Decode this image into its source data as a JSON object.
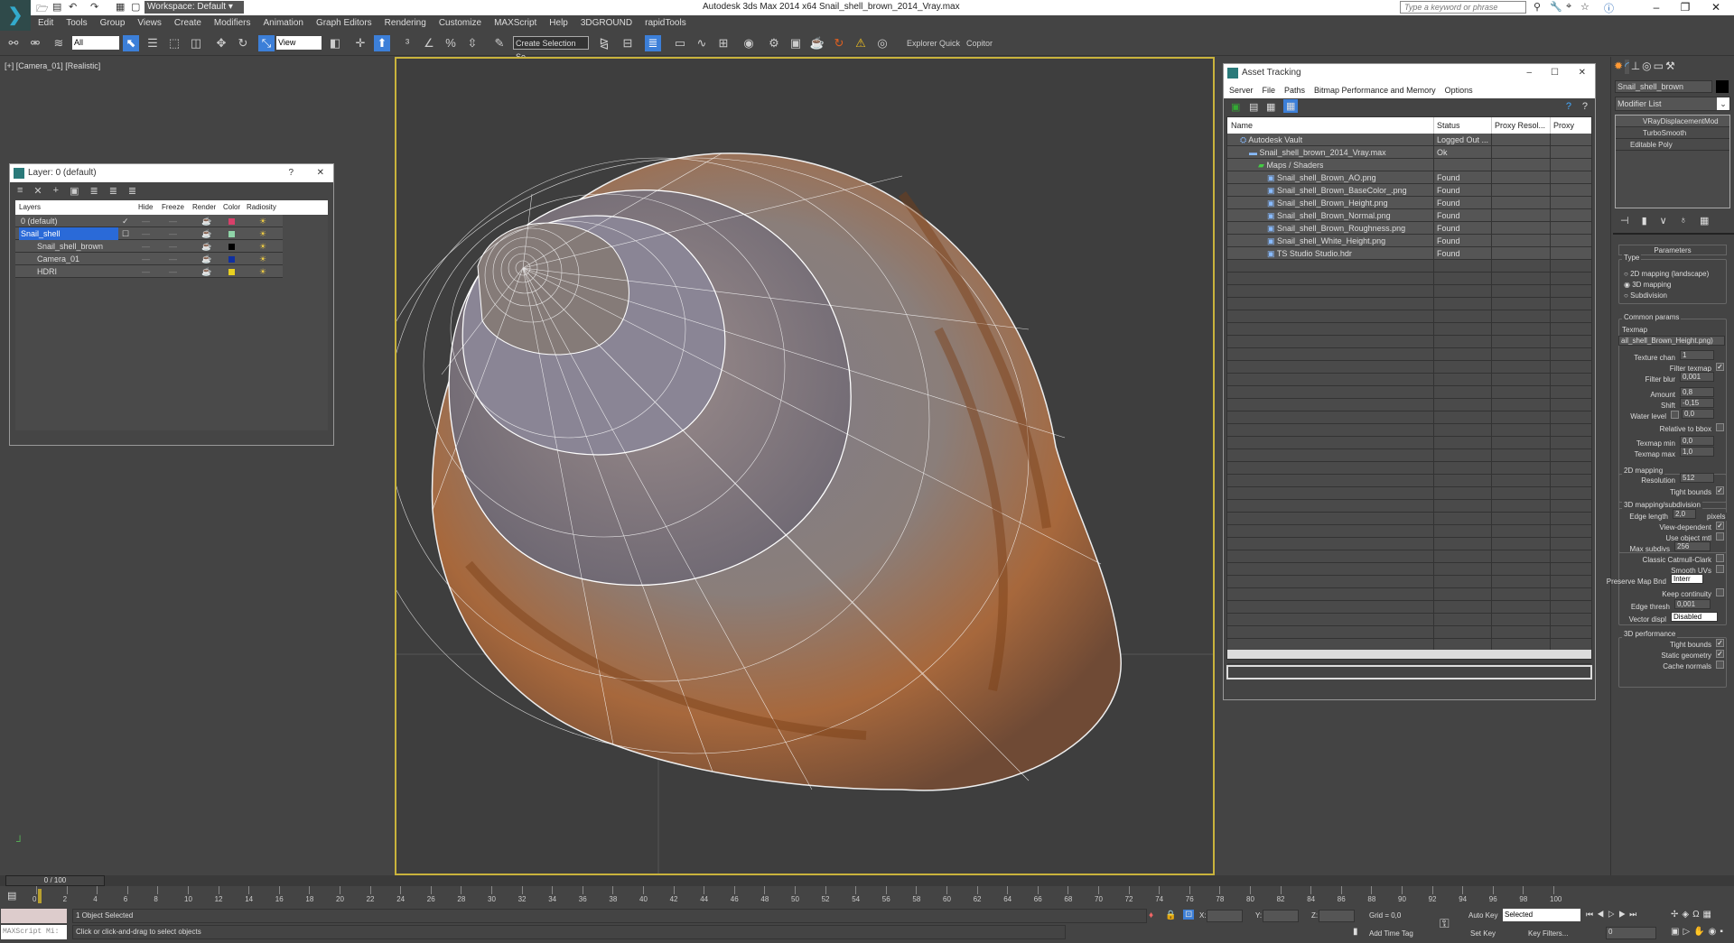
{
  "titlebar": {
    "workspace": "Workspace: Default",
    "title": "Autodesk 3ds Max  2014 x64     Snail_shell_brown_2014_Vray.max",
    "search_placeholder": "Type a keyword or phrase"
  },
  "menu": [
    "Edit",
    "Tools",
    "Group",
    "Views",
    "Create",
    "Modifiers",
    "Animation",
    "Graph Editors",
    "Rendering",
    "Customize",
    "MAXScript",
    "Help",
    "3DGROUND",
    "rapidTools"
  ],
  "toolbar": {
    "filter": "All",
    "coord": "View",
    "selection_set": "Create Selection Se",
    "explorer": "Explorer Quick",
    "copitor": "Copitor"
  },
  "viewport": {
    "label": "[+] [Camera_01] [Realistic]"
  },
  "layer_dialog": {
    "title": "Layer: 0 (default)",
    "help": "?",
    "columns": [
      "Layers",
      "Hide",
      "Freeze",
      "Render",
      "Color",
      "Radiosity"
    ],
    "rows": [
      {
        "name": "0 (default)",
        "current": "✓",
        "color": "#d8406a",
        "indent": 0
      },
      {
        "name": "Snail_shell",
        "current": "☐",
        "color": "#8fd4a8",
        "indent": 0,
        "selected": true
      },
      {
        "name": "Snail_shell_brown",
        "color": "#000000",
        "indent": 1
      },
      {
        "name": "Camera_01",
        "color": "#1030a0",
        "indent": 1
      },
      {
        "name": "HDRI",
        "color": "#e8d020",
        "indent": 1
      }
    ]
  },
  "asset_tracking": {
    "title": "Asset Tracking",
    "menu": [
      "Server",
      "File",
      "Paths",
      "Bitmap Performance and Memory",
      "Options"
    ],
    "columns": [
      "Name",
      "Status",
      "Proxy Resol...",
      "Proxy Status"
    ],
    "rows": [
      {
        "name": "Autodesk Vault",
        "status": "Logged Out ...",
        "indent": 1
      },
      {
        "name": "Snail_shell_brown_2014_Vray.max",
        "status": "Ok",
        "indent": 2
      },
      {
        "name": "Maps / Shaders",
        "status": "",
        "indent": 3
      },
      {
        "name": "Snail_shell_Brown_AO.png",
        "status": "Found",
        "indent": 4
      },
      {
        "name": "Snail_shell_Brown_BaseColor_.png",
        "status": "Found",
        "indent": 4
      },
      {
        "name": "Snail_shell_Brown_Height.png",
        "status": "Found",
        "indent": 4
      },
      {
        "name": "Snail_shell_Brown_Normal.png",
        "status": "Found",
        "indent": 4
      },
      {
        "name": "Snail_shell_Brown_Roughness.png",
        "status": "Found",
        "indent": 4
      },
      {
        "name": "Snail_shell_White_Height.png",
        "status": "Found",
        "indent": 4
      },
      {
        "name": "TS Studio Studio.hdr",
        "status": "Found",
        "indent": 4
      }
    ]
  },
  "command_panel": {
    "object_name": "Snail_shell_brown",
    "modifier_list": "Modifier List",
    "stack": [
      "VRayDisplacementMod",
      "TurboSmooth",
      "Editable Poly"
    ],
    "rollout": "Parameters",
    "type_label": "Type",
    "types": [
      "2D mapping (landscape)",
      "3D mapping",
      "Subdivision"
    ],
    "type_selected": 1,
    "common_label": "Common params",
    "texmap_label": "Texmap",
    "texmap": "ail_shell_Brown_Height.png)",
    "texture_chan_label": "Texture chan",
    "texture_chan": "1",
    "filter_texmap": "Filter texmap",
    "filter_blur_label": "Filter blur",
    "filter_blur": "0,001",
    "amount_label": "Amount",
    "amount": "0,8",
    "shift_label": "Shift",
    "shift": "-0,15",
    "water_label": "Water level",
    "water": "0,0",
    "relative": "Relative to bbox",
    "tmin_label": "Texmap min",
    "tmin": "0,0",
    "tmax_label": "Texmap max",
    "tmax": "1,0",
    "map2d_label": "2D mapping",
    "resolution_label": "Resolution",
    "resolution": "512",
    "tight_bounds": "Tight bounds",
    "map3d_label": "3D mapping/subdivision",
    "edge_length_label": "Edge length",
    "edge_length": "2,0",
    "pixels": "pixels",
    "view_dependent": "View-dependent",
    "use_object_mtl": "Use object mtl",
    "max_subdivs_label": "Max subdivs",
    "max_subdivs": "256",
    "catmull": "Classic Catmull-Clark",
    "smooth_uvs": "Smooth UVs",
    "preserve_label": "Preserve Map Bnd",
    "preserve": "Interr",
    "keep_continuity": "Keep continuity",
    "edge_thresh_label": "Edge thresh",
    "edge_thresh": "0,001",
    "vector_label": "Vector displ",
    "vector": "Disabled",
    "perf_label": "3D performance",
    "perf_tight": "Tight bounds",
    "static_geo": "Static geometry",
    "cache_normals": "Cache normals"
  },
  "timeline": {
    "frame": "0 / 100",
    "ticks": [
      "0",
      "2",
      "4",
      "6",
      "8",
      "10",
      "12",
      "14",
      "16",
      "18",
      "20",
      "22",
      "24",
      "26",
      "28",
      "30",
      "32",
      "34",
      "36",
      "38",
      "40",
      "42",
      "44",
      "46",
      "48",
      "50",
      "52",
      "54",
      "56",
      "58",
      "60",
      "62",
      "64",
      "66",
      "68",
      "70",
      "72",
      "74",
      "76",
      "78",
      "80",
      "82",
      "84",
      "86",
      "88",
      "90",
      "92",
      "94",
      "96",
      "98",
      "100"
    ]
  },
  "status": {
    "maxscript": "MAXScript Mi:",
    "selected": "1 Object Selected",
    "prompt": "Click or click-and-drag to select objects",
    "x": "X:",
    "y": "Y:",
    "z": "Z:",
    "grid": "Grid = 0,0",
    "add_time_tag": "Add Time Tag",
    "auto_key": "Auto Key",
    "set_key": "Set Key",
    "key_mode": "Selected",
    "key_filters": "Key Filters...",
    "current_frame": "0"
  }
}
